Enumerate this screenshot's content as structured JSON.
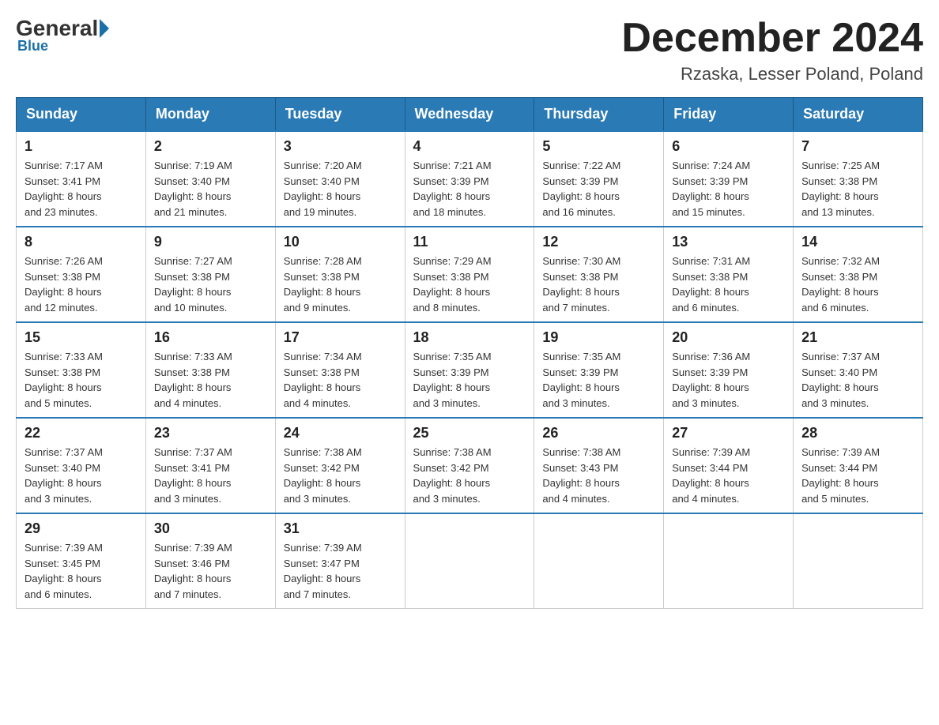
{
  "logo": {
    "general": "General",
    "blue": "Blue"
  },
  "title": "December 2024",
  "location": "Rzaska, Lesser Poland, Poland",
  "days_of_week": [
    "Sunday",
    "Monday",
    "Tuesday",
    "Wednesday",
    "Thursday",
    "Friday",
    "Saturday"
  ],
  "weeks": [
    [
      {
        "day": "1",
        "sunrise": "7:17 AM",
        "sunset": "3:41 PM",
        "daylight": "8 hours and 23 minutes."
      },
      {
        "day": "2",
        "sunrise": "7:19 AM",
        "sunset": "3:40 PM",
        "daylight": "8 hours and 21 minutes."
      },
      {
        "day": "3",
        "sunrise": "7:20 AM",
        "sunset": "3:40 PM",
        "daylight": "8 hours and 19 minutes."
      },
      {
        "day": "4",
        "sunrise": "7:21 AM",
        "sunset": "3:39 PM",
        "daylight": "8 hours and 18 minutes."
      },
      {
        "day": "5",
        "sunrise": "7:22 AM",
        "sunset": "3:39 PM",
        "daylight": "8 hours and 16 minutes."
      },
      {
        "day": "6",
        "sunrise": "7:24 AM",
        "sunset": "3:39 PM",
        "daylight": "8 hours and 15 minutes."
      },
      {
        "day": "7",
        "sunrise": "7:25 AM",
        "sunset": "3:38 PM",
        "daylight": "8 hours and 13 minutes."
      }
    ],
    [
      {
        "day": "8",
        "sunrise": "7:26 AM",
        "sunset": "3:38 PM",
        "daylight": "8 hours and 12 minutes."
      },
      {
        "day": "9",
        "sunrise": "7:27 AM",
        "sunset": "3:38 PM",
        "daylight": "8 hours and 10 minutes."
      },
      {
        "day": "10",
        "sunrise": "7:28 AM",
        "sunset": "3:38 PM",
        "daylight": "8 hours and 9 minutes."
      },
      {
        "day": "11",
        "sunrise": "7:29 AM",
        "sunset": "3:38 PM",
        "daylight": "8 hours and 8 minutes."
      },
      {
        "day": "12",
        "sunrise": "7:30 AM",
        "sunset": "3:38 PM",
        "daylight": "8 hours and 7 minutes."
      },
      {
        "day": "13",
        "sunrise": "7:31 AM",
        "sunset": "3:38 PM",
        "daylight": "8 hours and 6 minutes."
      },
      {
        "day": "14",
        "sunrise": "7:32 AM",
        "sunset": "3:38 PM",
        "daylight": "8 hours and 6 minutes."
      }
    ],
    [
      {
        "day": "15",
        "sunrise": "7:33 AM",
        "sunset": "3:38 PM",
        "daylight": "8 hours and 5 minutes."
      },
      {
        "day": "16",
        "sunrise": "7:33 AM",
        "sunset": "3:38 PM",
        "daylight": "8 hours and 4 minutes."
      },
      {
        "day": "17",
        "sunrise": "7:34 AM",
        "sunset": "3:38 PM",
        "daylight": "8 hours and 4 minutes."
      },
      {
        "day": "18",
        "sunrise": "7:35 AM",
        "sunset": "3:39 PM",
        "daylight": "8 hours and 3 minutes."
      },
      {
        "day": "19",
        "sunrise": "7:35 AM",
        "sunset": "3:39 PM",
        "daylight": "8 hours and 3 minutes."
      },
      {
        "day": "20",
        "sunrise": "7:36 AM",
        "sunset": "3:39 PM",
        "daylight": "8 hours and 3 minutes."
      },
      {
        "day": "21",
        "sunrise": "7:37 AM",
        "sunset": "3:40 PM",
        "daylight": "8 hours and 3 minutes."
      }
    ],
    [
      {
        "day": "22",
        "sunrise": "7:37 AM",
        "sunset": "3:40 PM",
        "daylight": "8 hours and 3 minutes."
      },
      {
        "day": "23",
        "sunrise": "7:37 AM",
        "sunset": "3:41 PM",
        "daylight": "8 hours and 3 minutes."
      },
      {
        "day": "24",
        "sunrise": "7:38 AM",
        "sunset": "3:42 PM",
        "daylight": "8 hours and 3 minutes."
      },
      {
        "day": "25",
        "sunrise": "7:38 AM",
        "sunset": "3:42 PM",
        "daylight": "8 hours and 3 minutes."
      },
      {
        "day": "26",
        "sunrise": "7:38 AM",
        "sunset": "3:43 PM",
        "daylight": "8 hours and 4 minutes."
      },
      {
        "day": "27",
        "sunrise": "7:39 AM",
        "sunset": "3:44 PM",
        "daylight": "8 hours and 4 minutes."
      },
      {
        "day": "28",
        "sunrise": "7:39 AM",
        "sunset": "3:44 PM",
        "daylight": "8 hours and 5 minutes."
      }
    ],
    [
      {
        "day": "29",
        "sunrise": "7:39 AM",
        "sunset": "3:45 PM",
        "daylight": "8 hours and 6 minutes."
      },
      {
        "day": "30",
        "sunrise": "7:39 AM",
        "sunset": "3:46 PM",
        "daylight": "8 hours and 7 minutes."
      },
      {
        "day": "31",
        "sunrise": "7:39 AM",
        "sunset": "3:47 PM",
        "daylight": "8 hours and 7 minutes."
      },
      null,
      null,
      null,
      null
    ]
  ],
  "labels": {
    "sunrise": "Sunrise:",
    "sunset": "Sunset:",
    "daylight": "Daylight:"
  }
}
